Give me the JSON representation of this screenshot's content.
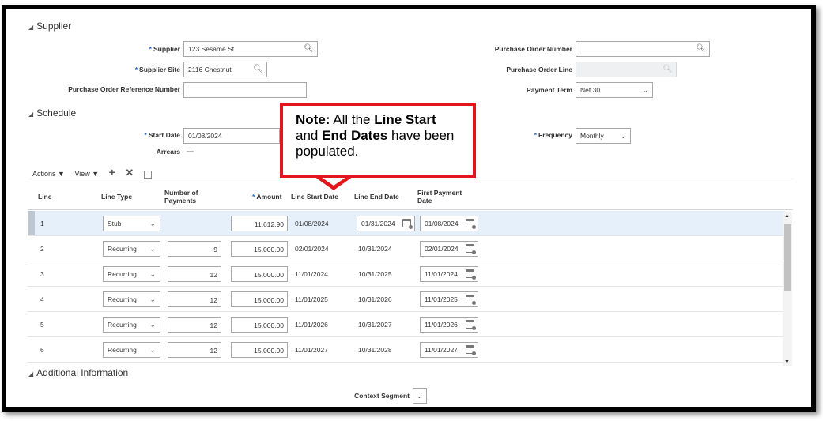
{
  "sections": {
    "supplier": "Supplier",
    "schedule": "Schedule",
    "additional": "Additional Information"
  },
  "supplier": {
    "supplier_label": "Supplier",
    "supplier_value": "123 Sesame St",
    "site_label": "Supplier Site",
    "site_value": "2116 Chestnut",
    "po_ref_label": "Purchase Order Reference Number",
    "po_ref_value": "",
    "po_number_label": "Purchase Order Number",
    "po_number_value": "",
    "po_line_label": "Purchase Order Line",
    "po_line_value": "",
    "payment_term_label": "Payment Term",
    "payment_term_value": "Net 30"
  },
  "schedule": {
    "start_date_label": "Start Date",
    "start_date_value": "01/08/2024",
    "arrears_label": "Arrears",
    "arrears_value": "—",
    "frequency_label": "Frequency",
    "frequency_value": "Monthly"
  },
  "toolbar": {
    "actions": "Actions ▼",
    "view": "View ▼"
  },
  "table": {
    "headers": {
      "line": "Line",
      "line_type": "Line Type",
      "num_payments": "Number of Payments",
      "amount": "Amount",
      "line_start": "Line Start Date",
      "line_end": "Line End Date",
      "first_payment": "First Payment Date"
    },
    "rows": [
      {
        "line": "1",
        "type": "Stub",
        "payments": "",
        "amount": "11,612.90",
        "start": "01/08/2024",
        "end": "01/31/2024",
        "first": "01/08/2024"
      },
      {
        "line": "2",
        "type": "Recurring",
        "payments": "9",
        "amount": "15,000.00",
        "start": "02/01/2024",
        "end": "10/31/2024",
        "first": "02/01/2024"
      },
      {
        "line": "3",
        "type": "Recurring",
        "payments": "12",
        "amount": "15,000.00",
        "start": "11/01/2024",
        "end": "10/31/2025",
        "first": "11/01/2024"
      },
      {
        "line": "4",
        "type": "Recurring",
        "payments": "12",
        "amount": "15,000.00",
        "start": "11/01/2025",
        "end": "10/31/2026",
        "first": "11/01/2025"
      },
      {
        "line": "5",
        "type": "Recurring",
        "payments": "12",
        "amount": "15,000.00",
        "start": "11/01/2026",
        "end": "10/31/2027",
        "first": "11/01/2026"
      },
      {
        "line": "6",
        "type": "Recurring",
        "payments": "12",
        "amount": "15,000.00",
        "start": "11/01/2027",
        "end": "10/31/2028",
        "first": "11/01/2027"
      }
    ]
  },
  "additional": {
    "context_label": "Context Segment"
  },
  "callout": {
    "note": "Note:",
    "t1": "All the",
    "b1": "Line Start",
    "t2": "and",
    "b2": "End Dates",
    "t3": "have been populated."
  },
  "icons": {
    "search": "search-icon",
    "calendar": "calendar-icon",
    "chevron": "chevron-down-icon",
    "add": "add-icon",
    "delete": "delete-icon",
    "detach": "detach-icon"
  },
  "colors": {
    "required": "#1e6fd0",
    "callout_border": "#e3161b",
    "selected_row": "#e6f0fa"
  }
}
